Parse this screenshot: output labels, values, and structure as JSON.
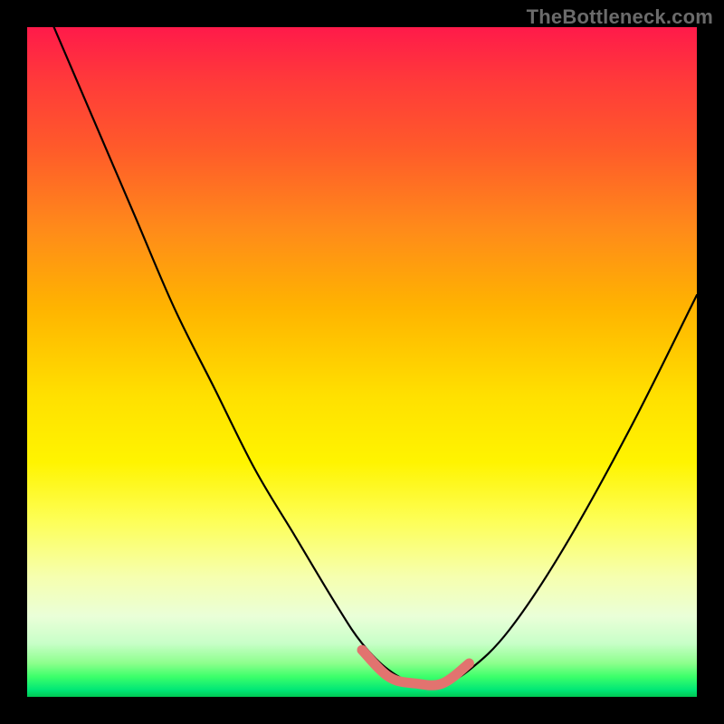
{
  "watermark": "TheBottleneck.com",
  "colors": {
    "frame": "#000000",
    "curve_main": "#000000",
    "curve_highlight": "#e2736f",
    "gradient_top": "#ff1a4a",
    "gradient_bottom": "#00c853"
  },
  "chart_data": {
    "type": "line",
    "title": "",
    "xlabel": "",
    "ylabel": "",
    "xlim": [
      0,
      100
    ],
    "ylim": [
      0,
      100
    ],
    "grid": false,
    "legend": false,
    "series": [
      {
        "name": "bottleneck-curve",
        "x": [
          4,
          10,
          16,
          22,
          28,
          34,
          40,
          46,
          50,
          54,
          58,
          62,
          66,
          72,
          80,
          90,
          100
        ],
        "y": [
          100,
          86,
          72,
          58,
          46,
          34,
          24,
          14,
          8,
          4,
          2,
          2,
          4,
          10,
          22,
          40,
          60
        ]
      },
      {
        "name": "optimal-range-highlight",
        "x": [
          50,
          54,
          58,
          62,
          66
        ],
        "y": [
          7,
          3,
          2,
          2,
          5
        ]
      }
    ],
    "annotations": []
  }
}
